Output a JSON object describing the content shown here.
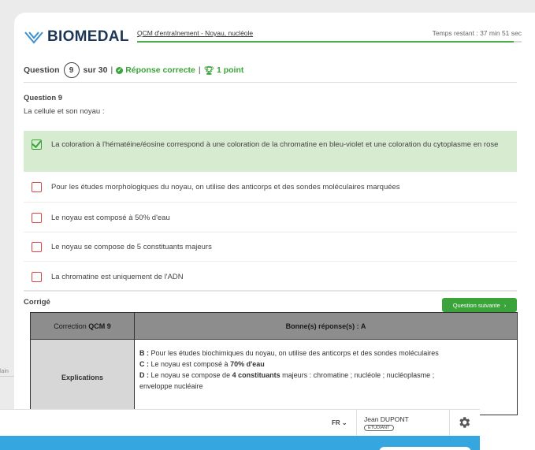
{
  "header": {
    "logo": "BIOMEDAL",
    "breadcrumb": "QCM d'entraînement - Noyau, nucléole",
    "timer": "Temps restant : 37 min 51 sec",
    "progress_fraction": 0.98
  },
  "question_status": {
    "label_prefix": "Question",
    "number": "9",
    "label_total": "sur 30",
    "result": "Réponse correcte",
    "points": "1 point"
  },
  "question": {
    "title": "Question 9",
    "text": "La cellule et son noyau :"
  },
  "answers": [
    {
      "text": "La coloration à l'hématéine/éosine correspond à une coloration de la chromatine en bleu-violet et une coloration du cytoplasme en rose",
      "checked": true
    },
    {
      "text": "Pour les études morphologiques du noyau, on utilise des anticorps et des sondes moléculaires marquées",
      "checked": false
    },
    {
      "text": "Le noyau est composé à 50% d'eau",
      "checked": false
    },
    {
      "text": "Le noyau se compose de 5 constituants majeurs",
      "checked": false
    },
    {
      "text": "La chromatine est uniquement de l'ADN",
      "checked": false
    }
  ],
  "corrige": {
    "label": "Corrigé",
    "next_button": "Question suivante"
  },
  "correction_table": {
    "header_left_prefix": "Correction ",
    "header_left_bold": "QCM 9",
    "header_right": "Bonne(s) réponse(s) : A",
    "row_label": "Explications",
    "lines": [
      {
        "key": "B :",
        "text": " Pour les études biochimiques du noyau, on utilise des anticorps et des sondes moléculaires"
      },
      {
        "key": "C :",
        "text": " Le noyau est composé à ",
        "bold": "70% d'eau"
      },
      {
        "key": "D :",
        "text": " Le noyau se compose de ",
        "bold": "4 constituants",
        "tail": " majeurs : chromatine ; nucléole ; nucléoplasme ;"
      },
      {
        "text": "enveloppe nucléaire"
      }
    ]
  },
  "sidebar_fragment": "lain",
  "bottom_bar": {
    "language": "FR",
    "user_name": "Jean DUPONT",
    "user_role": "ÉTUDIANT"
  },
  "colors": {
    "brand": "#1d3656",
    "correct_green": "#3aa43a",
    "correct_bg": "#d6ebcf",
    "wrong_red": "#d94545",
    "table_header": "#8d8d8d",
    "blue_bar": "#35a6e0"
  }
}
